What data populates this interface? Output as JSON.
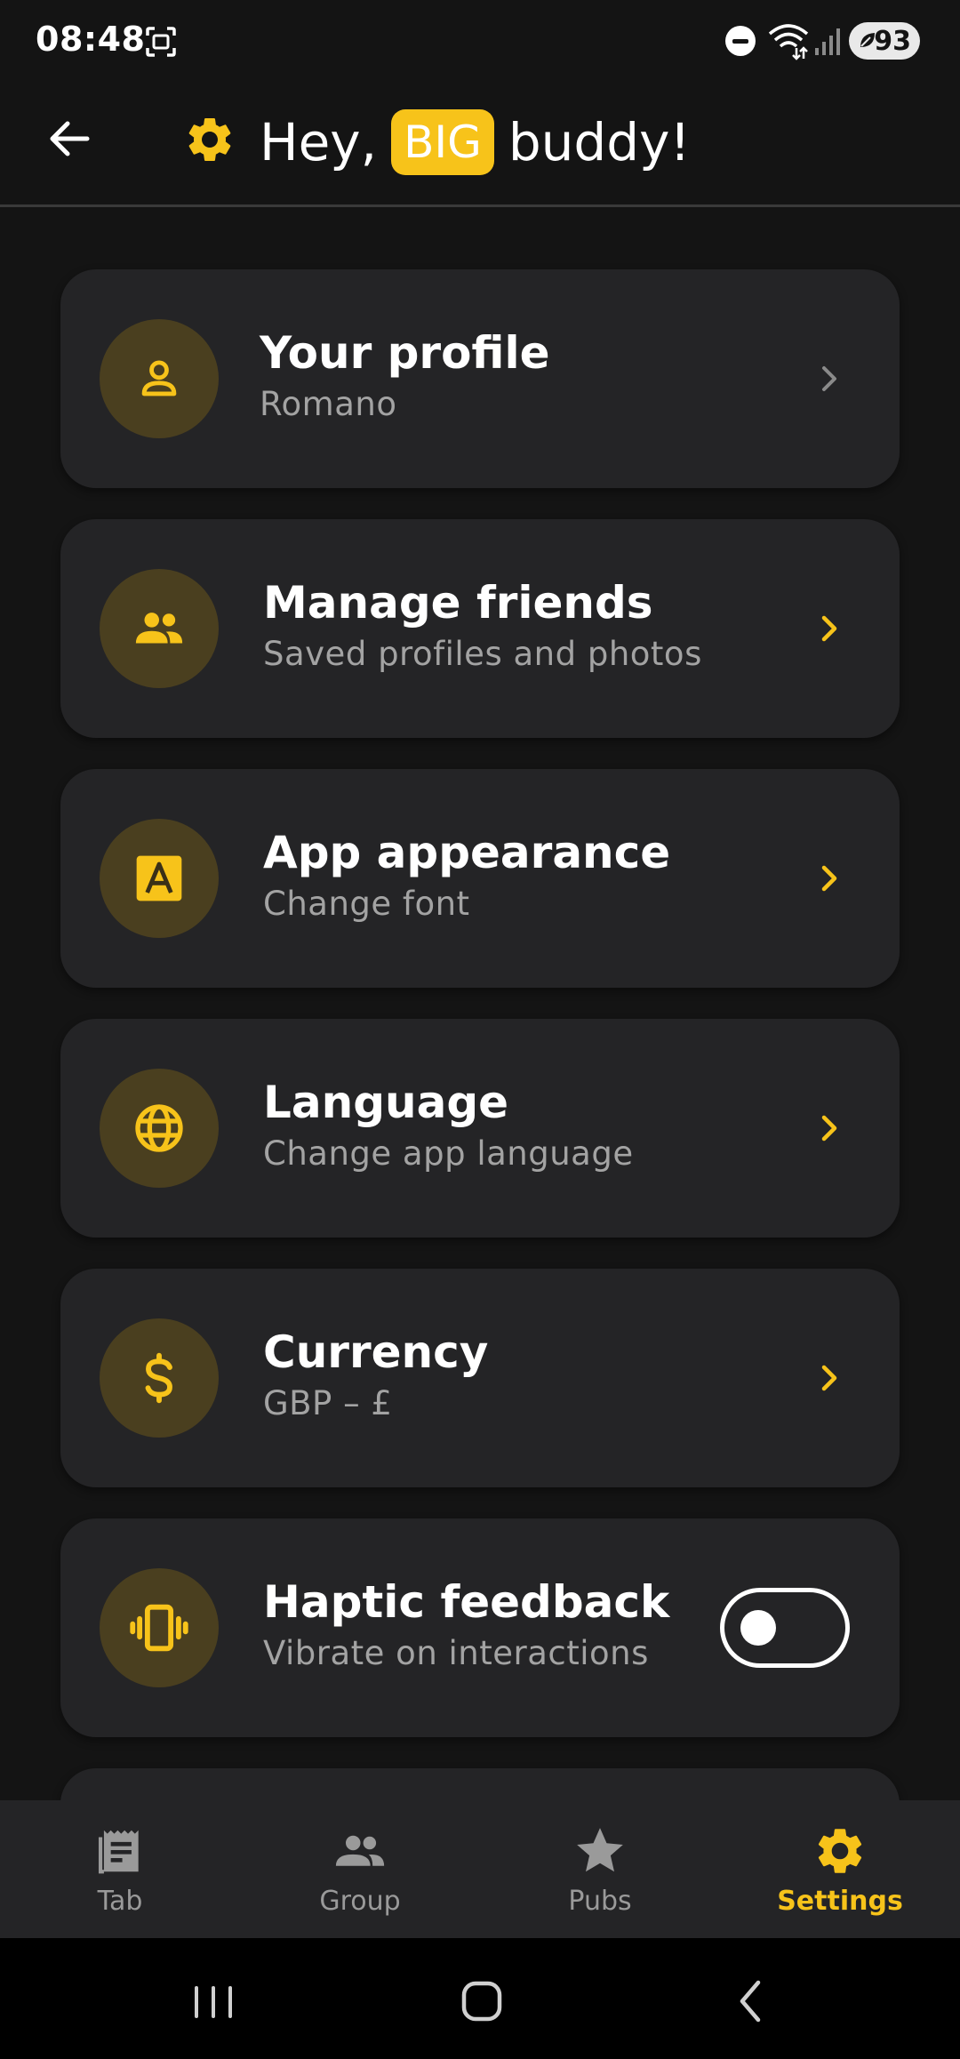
{
  "status_bar": {
    "time": "08:48",
    "battery": "93"
  },
  "header": {
    "title_prefix": "Hey,",
    "title_badge": "BIG",
    "title_suffix": "buddy!"
  },
  "settings": [
    {
      "label": "Your profile",
      "sub": "Romano",
      "icon": "person-icon",
      "chevron_color": "#8a8a8a"
    },
    {
      "label": "Manage friends",
      "sub": "Saved profiles and photos",
      "icon": "people-icon",
      "chevron_color": "#F7C31A"
    },
    {
      "label": "App appearance",
      "sub": "Change font",
      "icon": "font-icon",
      "chevron_color": "#F7C31A"
    },
    {
      "label": "Language",
      "sub": "Change app language",
      "icon": "globe-icon",
      "chevron_color": "#F7C31A"
    },
    {
      "label": "Currency",
      "sub": "GBP – £",
      "icon": "dollar-icon",
      "chevron_color": "#F7C31A"
    },
    {
      "label": "Haptic feedback",
      "sub": "Vibrate on interactions",
      "icon": "vibrate-icon",
      "toggle_on": false
    }
  ],
  "bottom_nav": [
    {
      "label": "Tab",
      "icon": "receipt-icon",
      "active": false
    },
    {
      "label": "Group",
      "icon": "group-icon",
      "active": false
    },
    {
      "label": "Pubs",
      "icon": "star-icon",
      "active": false
    },
    {
      "label": "Settings",
      "icon": "gear-icon",
      "active": true
    }
  ],
  "colors": {
    "accent": "#F7C31A",
    "background": "#141414",
    "card": "#242426",
    "icon_circle": "#4a3f1f"
  }
}
